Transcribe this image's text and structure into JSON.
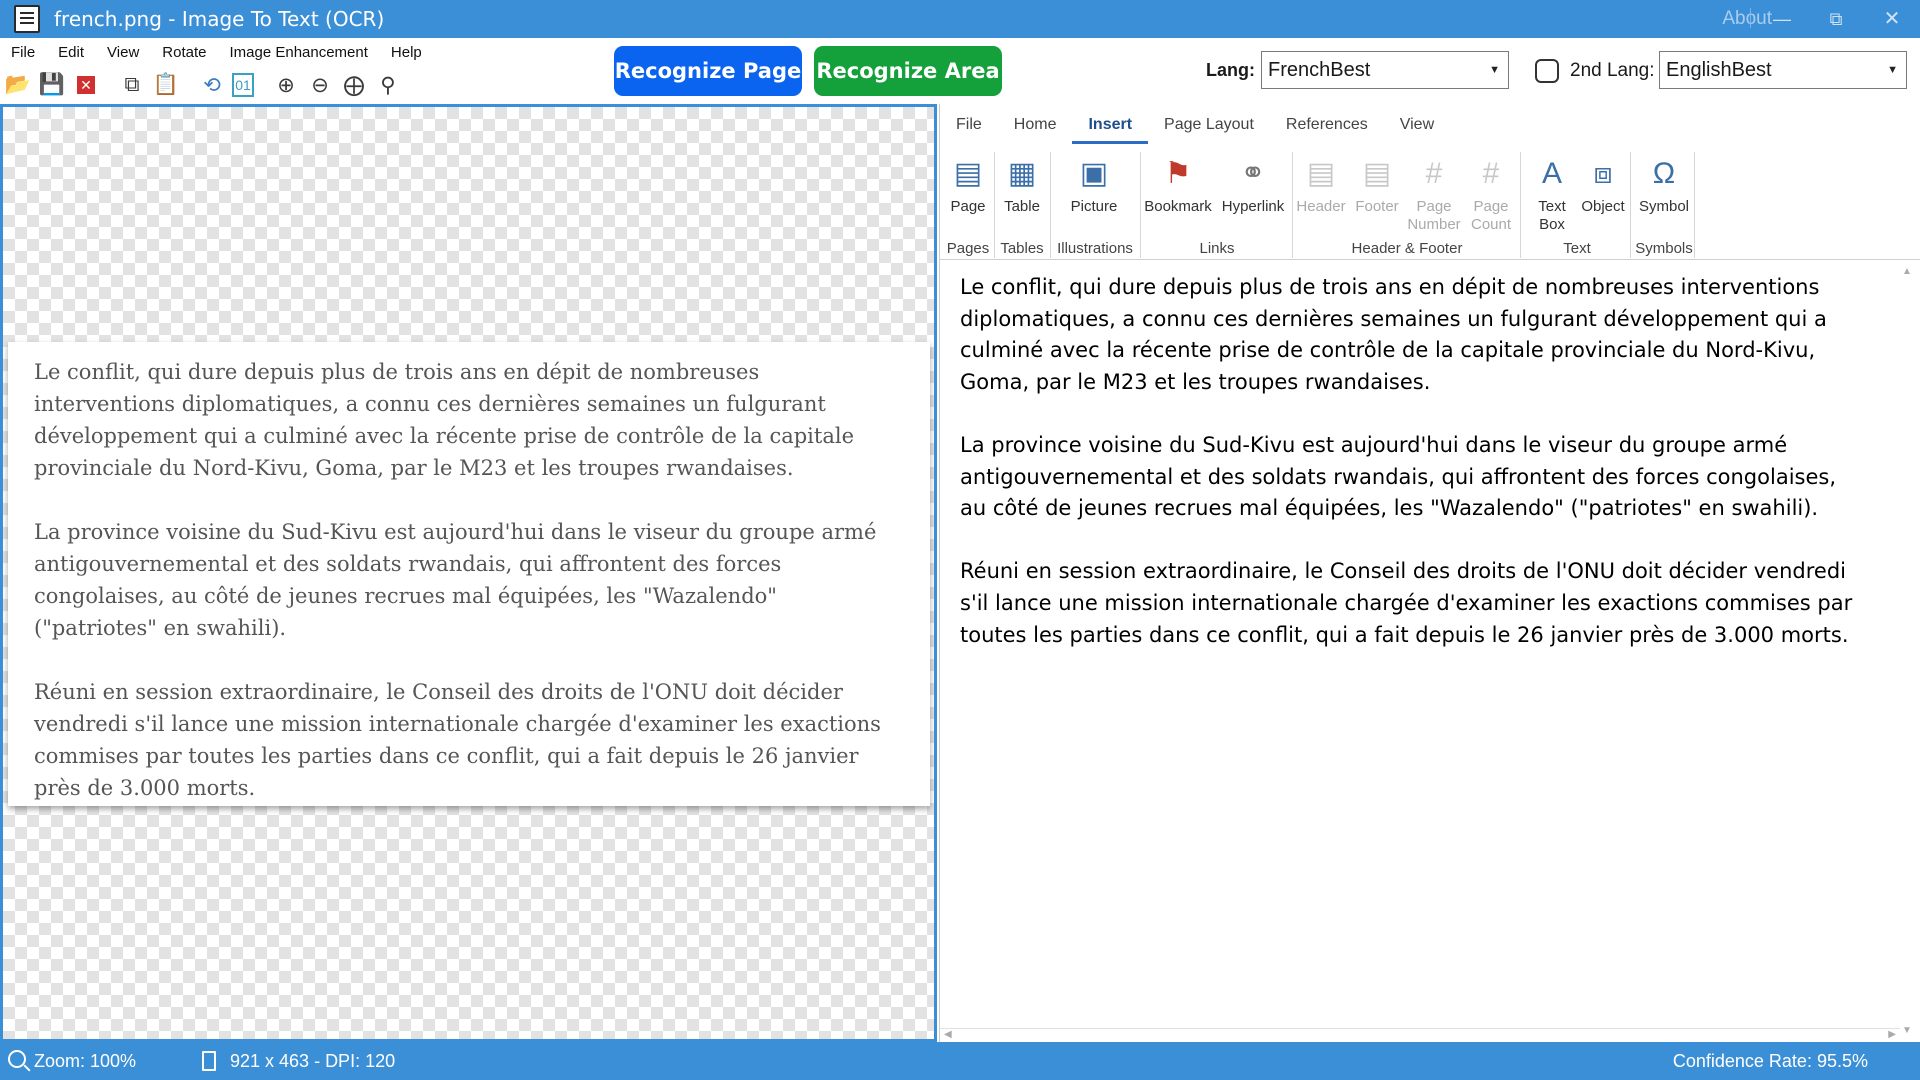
{
  "window": {
    "title": "french.png - Image To Text (OCR)",
    "about": "About",
    "minimize": "—",
    "maximize": "⧉",
    "close": "✕"
  },
  "menu": [
    "File",
    "Edit",
    "View",
    "Rotate",
    "Image Enhancement",
    "Help"
  ],
  "toolbar_icons": [
    "open-folder-icon",
    "save-icon",
    "close-file-icon",
    "copy-icon",
    "paste-icon",
    "rotate-icon",
    "binary-icon",
    "zoom-in-icon",
    "zoom-out-icon",
    "zoom-fit-icon",
    "zoom-100-icon"
  ],
  "actions": {
    "recognize_page": "Recognize Page",
    "recognize_area": "Recognize Area"
  },
  "lang": {
    "label": "Lang:",
    "value": "FrenchBest",
    "second_label": "2nd Lang:",
    "second_value": "EnglishBest",
    "second_enabled": false
  },
  "source_text": [
    "Le conflit, qui dure depuis plus de trois ans en dépit de nombreuses interventions diplomatiques, a connu ces dernières semaines un fulgurant développement qui a culminé avec la récente prise de contrôle de la capitale provinciale du Nord-Kivu, Goma, par le M23 et les troupes rwandaises.",
    "La province voisine du Sud-Kivu est aujourd'hui dans le viseur du groupe armé antigouvernemental et des soldats rwandais, qui affrontent des forces congolaises, au côté de jeunes recrues mal équipées, les \"Wazalendo\" (\"patriotes\" en swahili).",
    "Réuni en session extraordinaire, le Conseil des droits de l'ONU doit décider vendredi s'il lance une mission internationale chargée d'examiner les exactions commises par toutes les parties dans ce conflit, qui a fait depuis le 26 janvier près de 3.000 morts."
  ],
  "ribbon": {
    "tabs": [
      "File",
      "Home",
      "Insert",
      "Page Layout",
      "References",
      "View"
    ],
    "active_tab": "Insert",
    "buttons": {
      "page": "Page",
      "table": "Table",
      "picture": "Picture",
      "bookmark": "Bookmark",
      "hyperlink": "Hyperlink",
      "header": "Header",
      "footer": "Footer",
      "page_number_1": "Page",
      "page_number_2": "Number",
      "page_count_1": "Page",
      "page_count_2": "Count",
      "text_box_1": "Text",
      "text_box_2": "Box",
      "object": "Object",
      "symbol": "Symbol"
    },
    "groups": {
      "pages": "Pages",
      "tables": "Tables",
      "illustrations": "Illustrations",
      "links": "Links",
      "header_footer": "Header & Footer",
      "text": "Text",
      "symbols": "Symbols"
    }
  },
  "editor_text": [
    "Le conflit, qui dure depuis plus de trois ans en dépit de nombreuses interventions diplomatiques, a connu ces dernières semaines un fulgurant développement qui a culminé avec la récente prise de contrôle de la capitale provinciale du Nord-Kivu, Goma, par le M23 et les troupes rwandaises.",
    "La province voisine du Sud-Kivu est aujourd'hui dans le viseur du groupe armé antigouvernemental et des soldats rwandais, qui affrontent des forces congolaises, au côté de jeunes recrues mal équipées, les \"Wazalendo\" (\"patriotes\" en swahili).",
    "Réuni en session extraordinaire, le Conseil des droits de l'ONU doit décider vendredi s'il lance une mission internationale chargée d'examiner les exactions commises par toutes les parties dans ce conflit, qui a fait depuis le 26 janvier près de 3.000 morts."
  ],
  "status": {
    "zoom": "Zoom: 100%",
    "size": "921 x 463 - DPI: 120",
    "confidence": "Confidence Rate: 95.5%"
  },
  "colors": {
    "titlebar": "#3b8fd7",
    "recognize_page": "#0a64f0",
    "recognize_area": "#14a03a"
  }
}
